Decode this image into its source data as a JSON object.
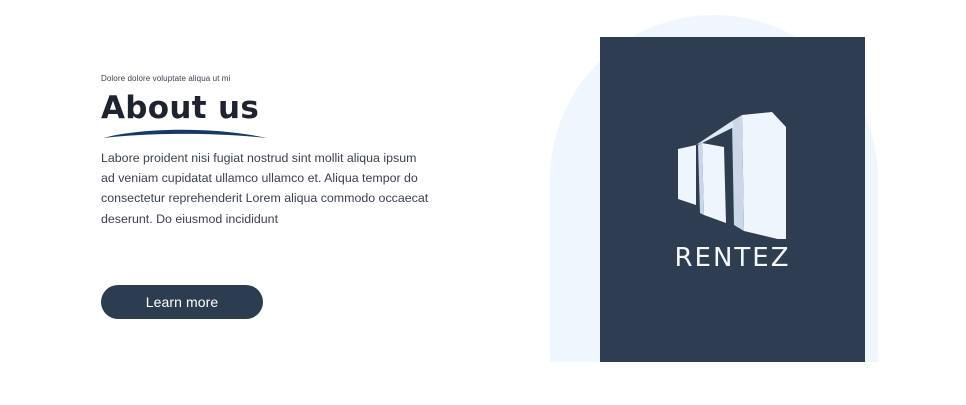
{
  "about": {
    "eyebrow": "Dolore dolore voluptate aliqua ut mi",
    "title": "About us",
    "paragraph": "Labore proident nisi fugiat nostrud sint mollit aliqua ipsum ad veniam cupidatat ullamco ullamco et. Aliqua tempor do consectetur reprehenderit Lorem aliqua commodo occaecat deserunt. Do eiusmod incididunt",
    "button_label": "Learn more"
  },
  "logo": {
    "brand_name": "RENTEZ",
    "icon": "buildings-icon"
  },
  "colors": {
    "primary_dark": "#2e3e50",
    "arch_background": "#f0f6fd",
    "swoosh": "#163a66"
  }
}
